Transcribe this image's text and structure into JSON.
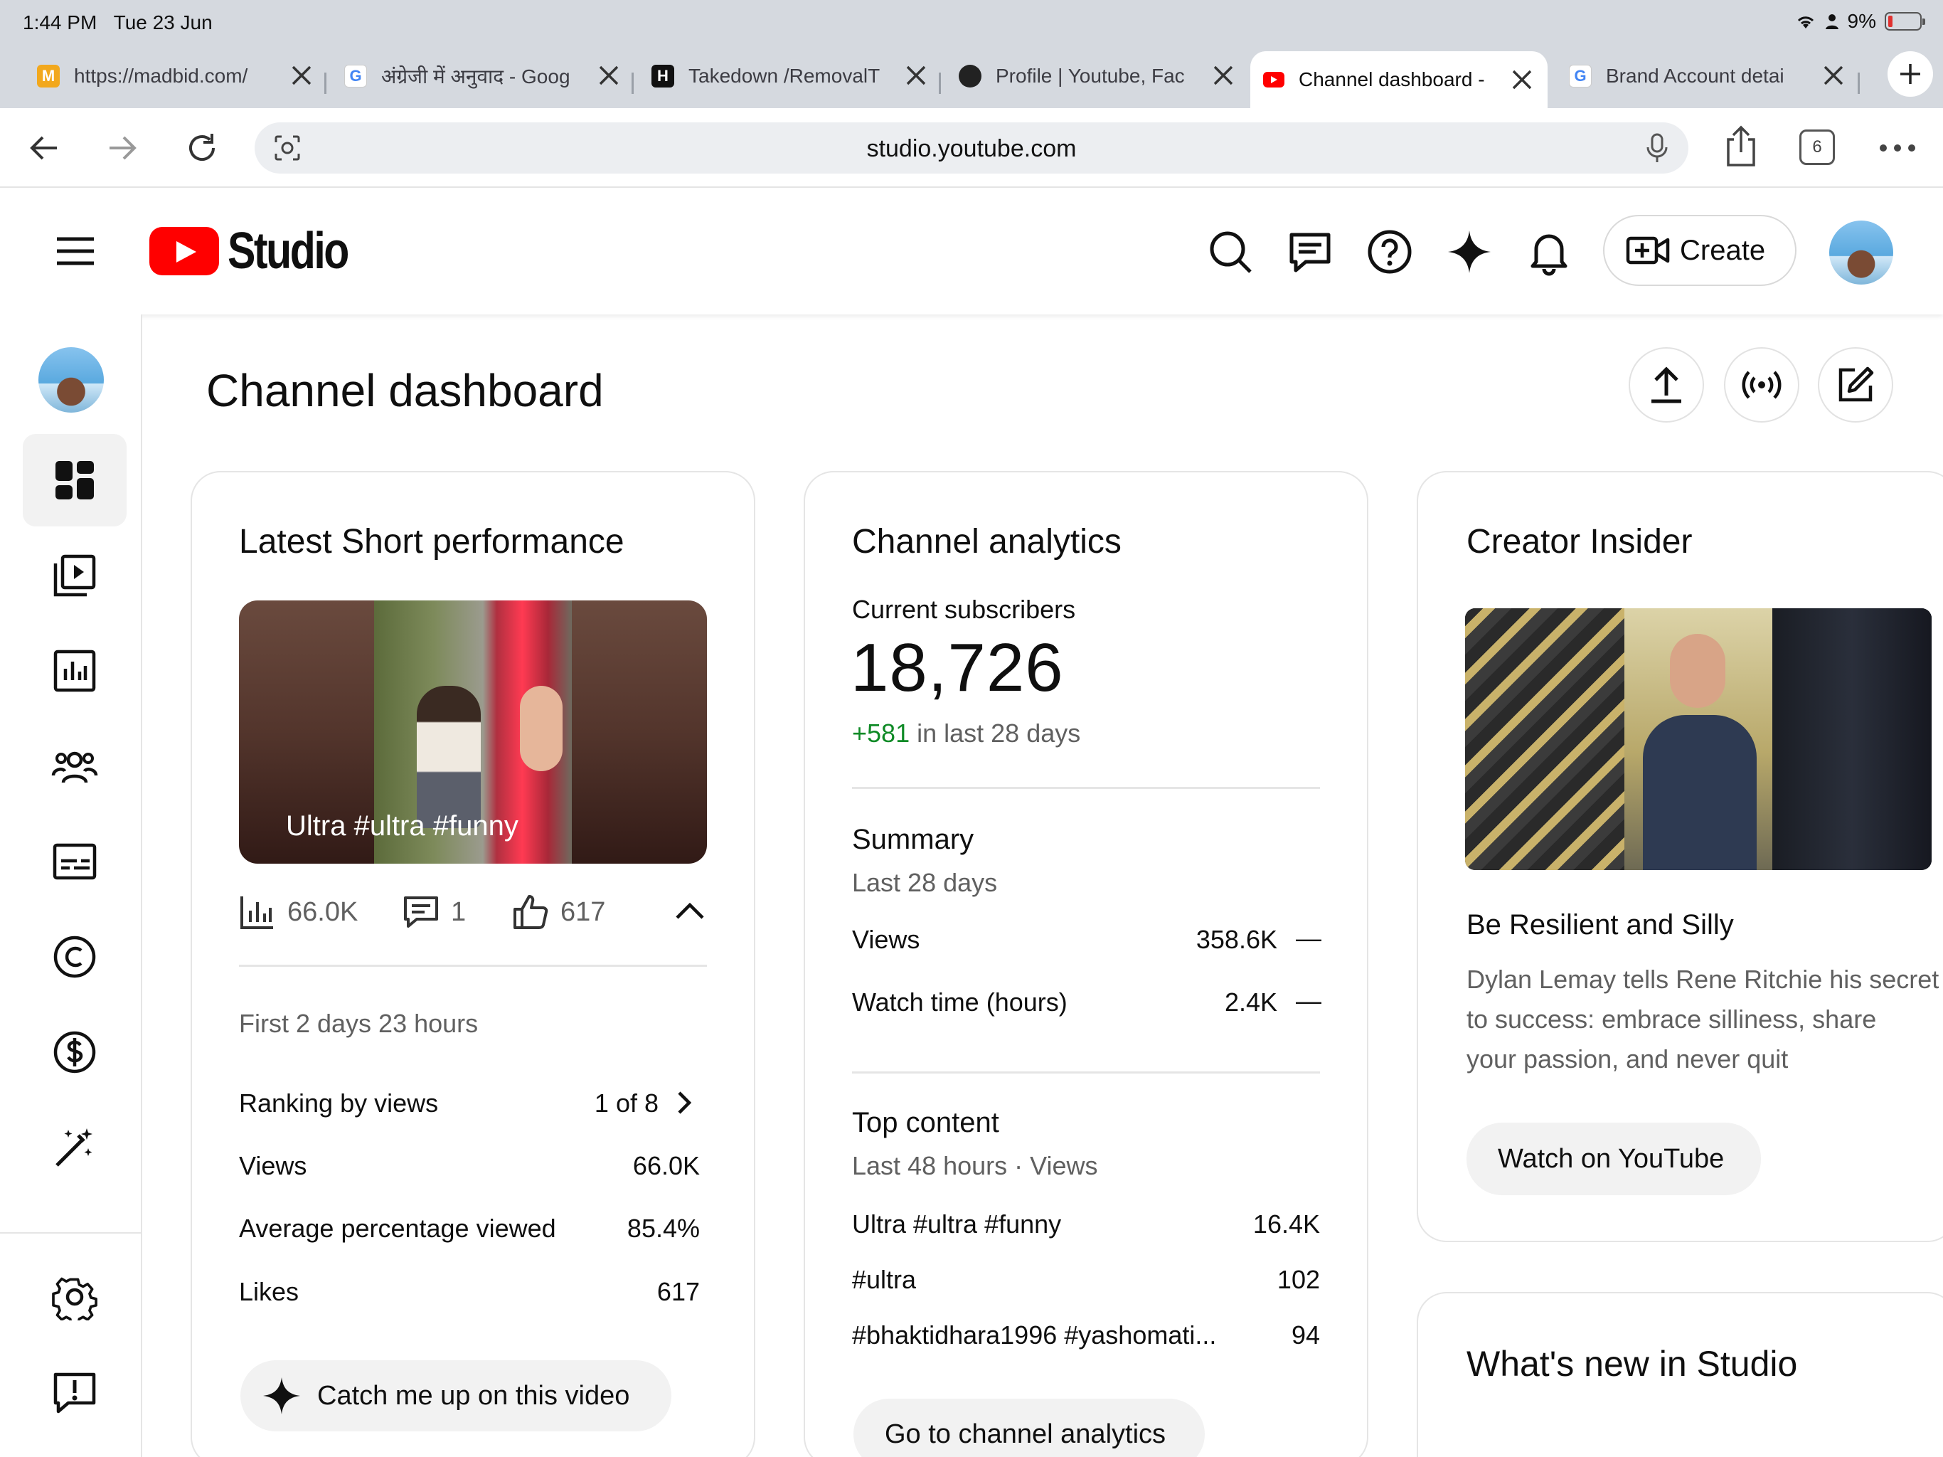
{
  "status": {
    "time": "1:44 PM",
    "date": "Tue 23 Jun",
    "battery": "9%"
  },
  "tabs": [
    {
      "title": "https://madbid.com/",
      "fav": "M"
    },
    {
      "title": "अंग्रेजी में अनुवाद - Goog",
      "fav": "G"
    },
    {
      "title": "Takedown /RemovalT",
      "fav": "H"
    },
    {
      "title": "Profile | Youtube, Fac",
      "fav": ""
    },
    {
      "title": "Channel dashboard -",
      "fav": ""
    },
    {
      "title": "Brand Account detai",
      "fav": "G"
    }
  ],
  "browser": {
    "url": "studio.youtube.com",
    "tab_count": "6"
  },
  "header": {
    "logo_text": "Studio",
    "create_label": "Create"
  },
  "page": {
    "title": "Channel dashboard"
  },
  "short": {
    "title": "Latest Short performance",
    "thumb_caption": "Ultra #ultra #funny",
    "views": "66.0K",
    "comments": "1",
    "likes": "617",
    "period": "First 2 days 23 hours",
    "rows": [
      {
        "label": "Ranking by views",
        "value": "1 of 8"
      },
      {
        "label": "Views",
        "value": "66.0K"
      },
      {
        "label": "Average percentage viewed",
        "value": "85.4%"
      },
      {
        "label": "Likes",
        "value": "617"
      }
    ],
    "catch_up_label": "Catch me up on this video"
  },
  "analytics": {
    "title": "Channel analytics",
    "subs_label": "Current subscribers",
    "subs_count": "18,726",
    "subs_delta": "+581",
    "subs_period": "in last 28 days",
    "summary_title": "Summary",
    "summary_period": "Last 28 days",
    "summary_rows": [
      {
        "label": "Views",
        "value": "358.6K",
        "trend": "—"
      },
      {
        "label": "Watch time (hours)",
        "value": "2.4K",
        "trend": "—"
      }
    ],
    "top_title": "Top content",
    "top_period": "Last 48 hours · Views",
    "top_rows": [
      {
        "label": "Ultra #ultra #funny",
        "value": "16.4K"
      },
      {
        "label": "#ultra",
        "value": "102"
      },
      {
        "label": "#bhaktidhara1996 #yashomati...",
        "value": "94"
      }
    ],
    "go_label": "Go to channel analytics"
  },
  "insider": {
    "title": "Creator Insider",
    "video_title": "Be Resilient and Silly",
    "desc_1": "Dylan Lemay tells Rene Ritchie his secret",
    "desc_2": "to success: embrace silliness, share",
    "desc_3": "your passion, and never quit",
    "watch_label": "Watch on YouTube"
  },
  "whatsnew": {
    "title": "What's new in Studio"
  },
  "colors": {
    "brand": "#ff0000",
    "positive": "#0f8a26",
    "muted": "#606060"
  },
  "icons": [
    "menu-icon",
    "search-icon",
    "comments-icon",
    "help-icon",
    "sparkle-icon",
    "bell-icon",
    "create-video-icon",
    "upload-icon",
    "live-icon",
    "edit-icon",
    "dashboard-icon",
    "content-icon",
    "analytics-icon",
    "community-icon",
    "subtitles-icon",
    "copyright-icon",
    "earn-icon",
    "customization-icon",
    "settings-icon",
    "feedback-icon"
  ]
}
